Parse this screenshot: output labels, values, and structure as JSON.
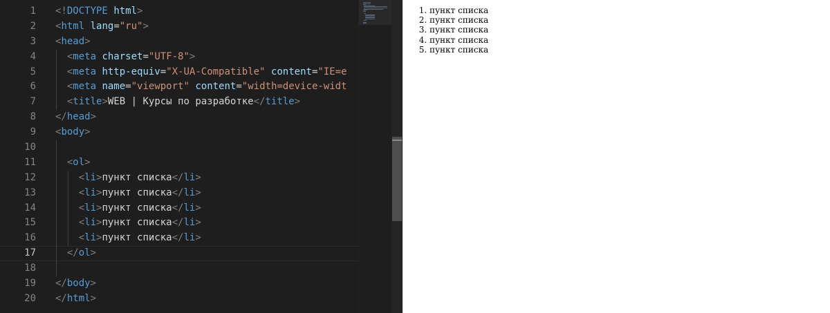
{
  "editor": {
    "active_line": 17,
    "lines": [
      {
        "n": "1",
        "tokens": [
          {
            "t": "<!",
            "c": "punc"
          },
          {
            "t": "DOCTYPE",
            "c": "tag"
          },
          {
            "t": " ",
            "c": "text"
          },
          {
            "t": "html",
            "c": "attr"
          },
          {
            "t": ">",
            "c": "punc"
          }
        ]
      },
      {
        "n": "2",
        "tokens": [
          {
            "t": "<",
            "c": "punc"
          },
          {
            "t": "html",
            "c": "tag"
          },
          {
            "t": " ",
            "c": "text"
          },
          {
            "t": "lang",
            "c": "attr"
          },
          {
            "t": "=",
            "c": "eq"
          },
          {
            "t": "\"ru\"",
            "c": "str"
          },
          {
            "t": ">",
            "c": "punc"
          }
        ]
      },
      {
        "n": "3",
        "tokens": [
          {
            "t": "<",
            "c": "punc"
          },
          {
            "t": "head",
            "c": "tag"
          },
          {
            "t": ">",
            "c": "punc"
          }
        ]
      },
      {
        "n": "4",
        "tokens": [
          {
            "t": "  ",
            "c": "text"
          },
          {
            "t": "<",
            "c": "punc"
          },
          {
            "t": "meta",
            "c": "tag"
          },
          {
            "t": " ",
            "c": "text"
          },
          {
            "t": "charset",
            "c": "attr"
          },
          {
            "t": "=",
            "c": "eq"
          },
          {
            "t": "\"UTF-8\"",
            "c": "str"
          },
          {
            "t": ">",
            "c": "punc"
          }
        ]
      },
      {
        "n": "5",
        "tokens": [
          {
            "t": "  ",
            "c": "text"
          },
          {
            "t": "<",
            "c": "punc"
          },
          {
            "t": "meta",
            "c": "tag"
          },
          {
            "t": " ",
            "c": "text"
          },
          {
            "t": "http-equiv",
            "c": "attr"
          },
          {
            "t": "=",
            "c": "eq"
          },
          {
            "t": "\"X-UA-Compatible\"",
            "c": "str"
          },
          {
            "t": " ",
            "c": "text"
          },
          {
            "t": "content",
            "c": "attr"
          },
          {
            "t": "=",
            "c": "eq"
          },
          {
            "t": "\"IE=e",
            "c": "str"
          }
        ]
      },
      {
        "n": "6",
        "tokens": [
          {
            "t": "  ",
            "c": "text"
          },
          {
            "t": "<",
            "c": "punc"
          },
          {
            "t": "meta",
            "c": "tag"
          },
          {
            "t": " ",
            "c": "text"
          },
          {
            "t": "name",
            "c": "attr"
          },
          {
            "t": "=",
            "c": "eq"
          },
          {
            "t": "\"viewport\"",
            "c": "str"
          },
          {
            "t": " ",
            "c": "text"
          },
          {
            "t": "content",
            "c": "attr"
          },
          {
            "t": "=",
            "c": "eq"
          },
          {
            "t": "\"width=device-widt",
            "c": "str"
          }
        ]
      },
      {
        "n": "7",
        "tokens": [
          {
            "t": "  ",
            "c": "text"
          },
          {
            "t": "<",
            "c": "punc"
          },
          {
            "t": "title",
            "c": "tag"
          },
          {
            "t": ">",
            "c": "punc"
          },
          {
            "t": "WEB | Курсы по разработке",
            "c": "text"
          },
          {
            "t": "</",
            "c": "punc"
          },
          {
            "t": "title",
            "c": "tag"
          },
          {
            "t": ">",
            "c": "punc"
          }
        ]
      },
      {
        "n": "8",
        "tokens": [
          {
            "t": "</",
            "c": "punc"
          },
          {
            "t": "head",
            "c": "tag"
          },
          {
            "t": ">",
            "c": "punc"
          }
        ]
      },
      {
        "n": "9",
        "tokens": [
          {
            "t": "<",
            "c": "punc"
          },
          {
            "t": "body",
            "c": "tag"
          },
          {
            "t": ">",
            "c": "punc"
          }
        ]
      },
      {
        "n": "10",
        "tokens": []
      },
      {
        "n": "11",
        "tokens": [
          {
            "t": "  ",
            "c": "text"
          },
          {
            "t": "<",
            "c": "punc"
          },
          {
            "t": "ol",
            "c": "tag"
          },
          {
            "t": ">",
            "c": "punc"
          }
        ]
      },
      {
        "n": "12",
        "tokens": [
          {
            "t": "    ",
            "c": "text"
          },
          {
            "t": "<",
            "c": "punc"
          },
          {
            "t": "li",
            "c": "tag"
          },
          {
            "t": ">",
            "c": "punc"
          },
          {
            "t": "пункт списка",
            "c": "text"
          },
          {
            "t": "</",
            "c": "punc"
          },
          {
            "t": "li",
            "c": "tag"
          },
          {
            "t": ">",
            "c": "punc"
          }
        ]
      },
      {
        "n": "13",
        "tokens": [
          {
            "t": "    ",
            "c": "text"
          },
          {
            "t": "<",
            "c": "punc"
          },
          {
            "t": "li",
            "c": "tag"
          },
          {
            "t": ">",
            "c": "punc"
          },
          {
            "t": "пункт списка",
            "c": "text"
          },
          {
            "t": "</",
            "c": "punc"
          },
          {
            "t": "li",
            "c": "tag"
          },
          {
            "t": ">",
            "c": "punc"
          }
        ]
      },
      {
        "n": "14",
        "tokens": [
          {
            "t": "    ",
            "c": "text"
          },
          {
            "t": "<",
            "c": "punc"
          },
          {
            "t": "li",
            "c": "tag"
          },
          {
            "t": ">",
            "c": "punc"
          },
          {
            "t": "пункт списка",
            "c": "text"
          },
          {
            "t": "</",
            "c": "punc"
          },
          {
            "t": "li",
            "c": "tag"
          },
          {
            "t": ">",
            "c": "punc"
          }
        ]
      },
      {
        "n": "15",
        "tokens": [
          {
            "t": "    ",
            "c": "text"
          },
          {
            "t": "<",
            "c": "punc"
          },
          {
            "t": "li",
            "c": "tag"
          },
          {
            "t": ">",
            "c": "punc"
          },
          {
            "t": "пункт списка",
            "c": "text"
          },
          {
            "t": "</",
            "c": "punc"
          },
          {
            "t": "li",
            "c": "tag"
          },
          {
            "t": ">",
            "c": "punc"
          }
        ]
      },
      {
        "n": "16",
        "tokens": [
          {
            "t": "    ",
            "c": "text"
          },
          {
            "t": "<",
            "c": "punc"
          },
          {
            "t": "li",
            "c": "tag"
          },
          {
            "t": ">",
            "c": "punc"
          },
          {
            "t": "пункт списка",
            "c": "text"
          },
          {
            "t": "</",
            "c": "punc"
          },
          {
            "t": "li",
            "c": "tag"
          },
          {
            "t": ">",
            "c": "punc"
          }
        ]
      },
      {
        "n": "17",
        "tokens": [
          {
            "t": "  ",
            "c": "text"
          },
          {
            "t": "</",
            "c": "punc"
          },
          {
            "t": "ol",
            "c": "tag"
          },
          {
            "t": ">",
            "c": "punc"
          }
        ]
      },
      {
        "n": "18",
        "tokens": []
      },
      {
        "n": "19",
        "tokens": [
          {
            "t": "</",
            "c": "punc"
          },
          {
            "t": "body",
            "c": "tag"
          },
          {
            "t": ">",
            "c": "punc"
          }
        ]
      },
      {
        "n": "20",
        "tokens": [
          {
            "t": "</",
            "c": "punc"
          },
          {
            "t": "html",
            "c": "tag"
          },
          {
            "t": ">",
            "c": "punc"
          }
        ]
      }
    ]
  },
  "preview": {
    "list_items": [
      "пункт списка",
      "пункт списка",
      "пункт списка",
      "пункт списка",
      "пункт списка"
    ]
  },
  "colors": {
    "editor_bg": "#1e1e1e",
    "tag": "#569cd6",
    "attribute": "#9cdcfe",
    "string": "#ce9178",
    "punctuation": "#808080",
    "text": "#d4d4d4",
    "line_number": "#858585"
  }
}
